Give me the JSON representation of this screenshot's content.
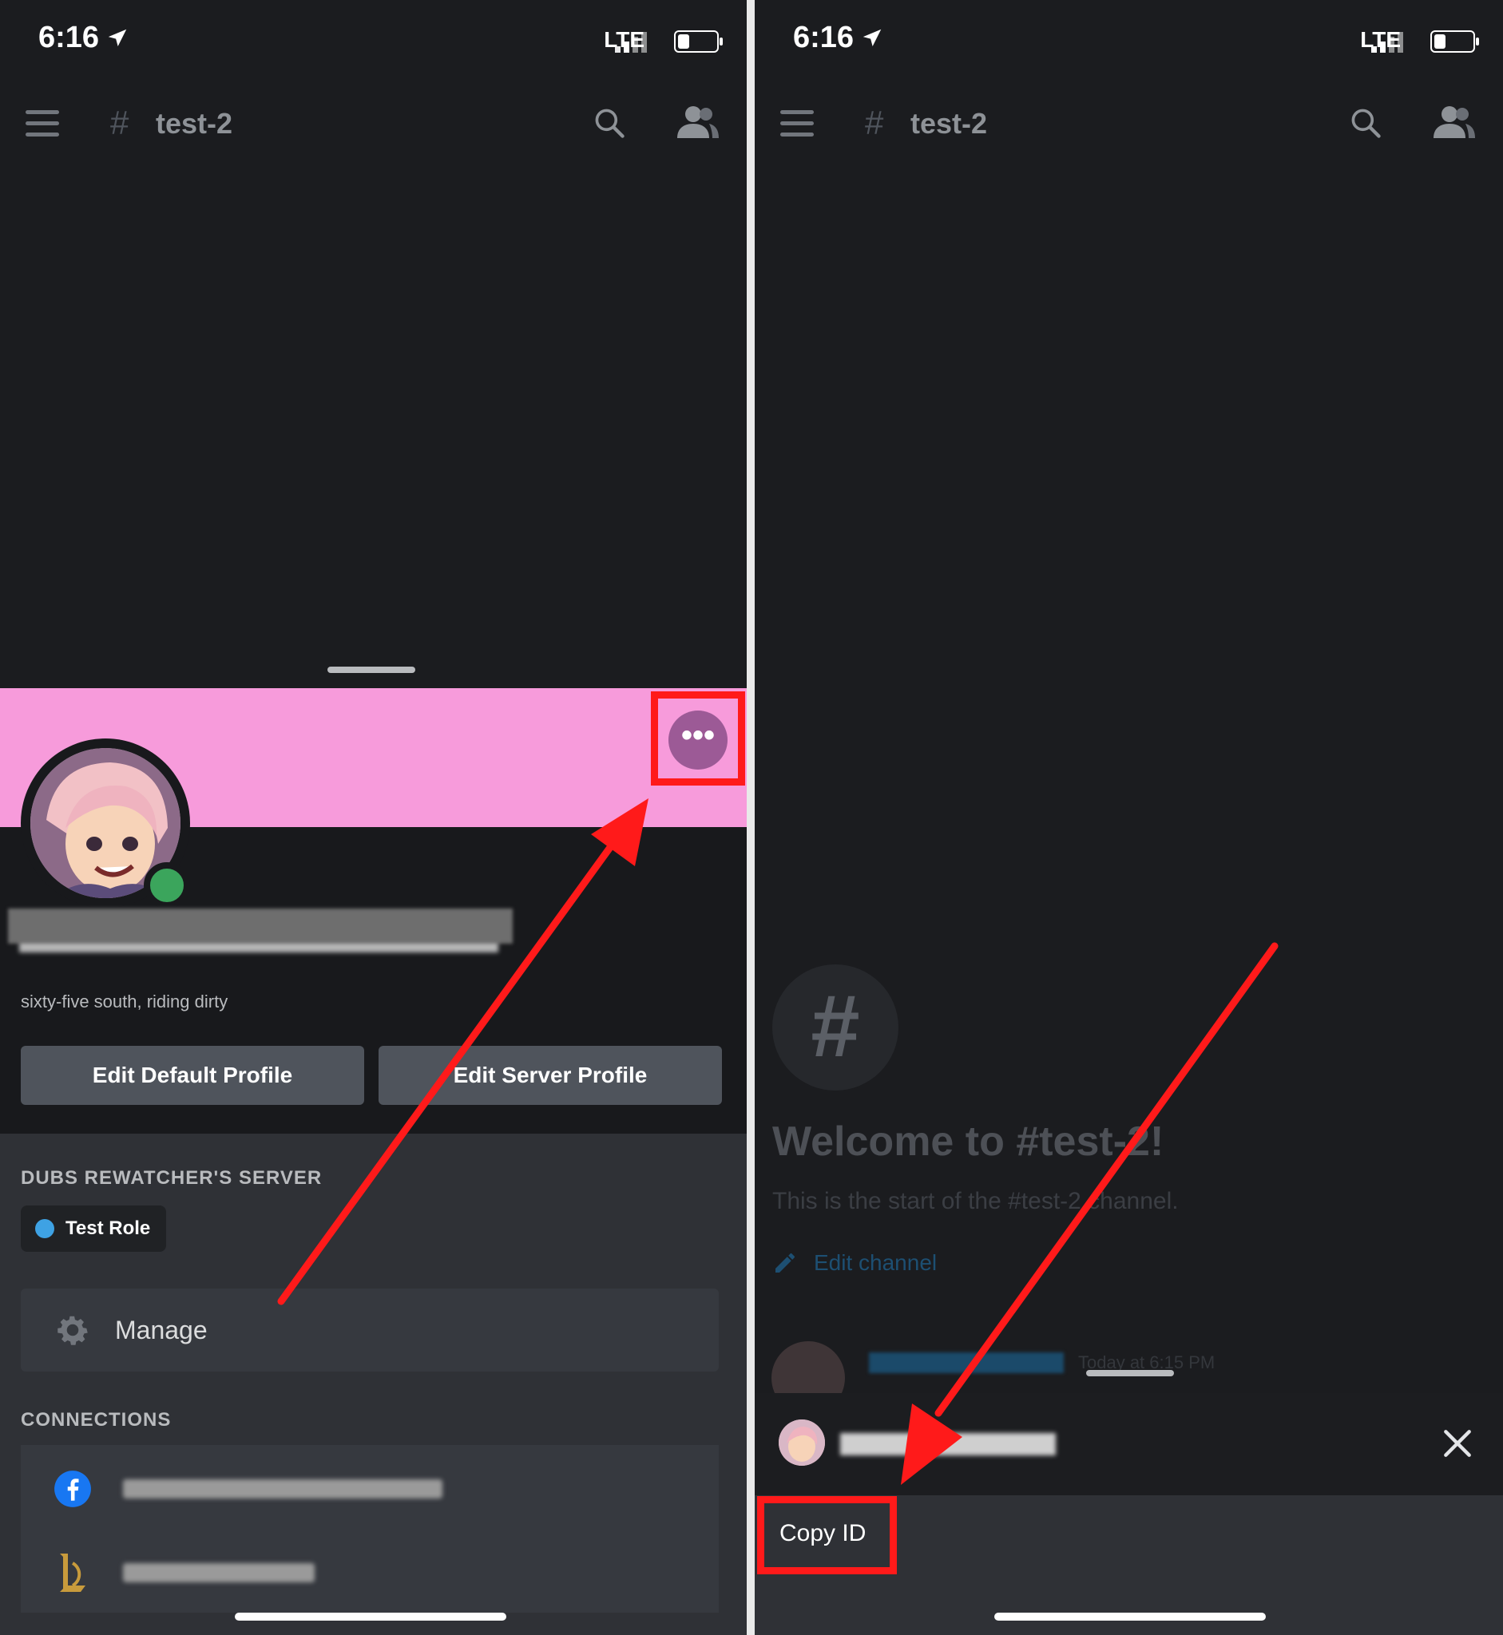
{
  "status": {
    "time": "6:16",
    "network": "LTE"
  },
  "channel": {
    "hash": "#",
    "name": "test-2"
  },
  "profile": {
    "bio": "sixty-five south, riding dirty",
    "buttons": {
      "edit_default": "Edit Default Profile",
      "edit_server": "Edit Server Profile"
    },
    "more_glyph": "•••",
    "server_section": "DUBS REWATCHER'S SERVER",
    "role": "Test Role",
    "manage": "Manage",
    "connections_section": "CONNECTIONS"
  },
  "channel_intro": {
    "hash_glyph": "#",
    "welcome": "Welcome to #test-2!",
    "start_text": "This is the start of the #test-2 channel.",
    "edit_channel": "Edit channel",
    "message_time": "Today at 6:15 PM"
  },
  "context_menu": {
    "copy_id": "Copy ID"
  },
  "colors": {
    "banner": "#f79bdb",
    "accent_red": "#ff1a1a",
    "online": "#3ba55c",
    "role_dot": "#3ea2e4"
  },
  "icons": [
    "hamburger-icon",
    "search-icon",
    "members-icon",
    "gear-icon",
    "facebook-icon",
    "league-icon",
    "pencil-icon",
    "close-icon",
    "location-arrow-icon"
  ]
}
